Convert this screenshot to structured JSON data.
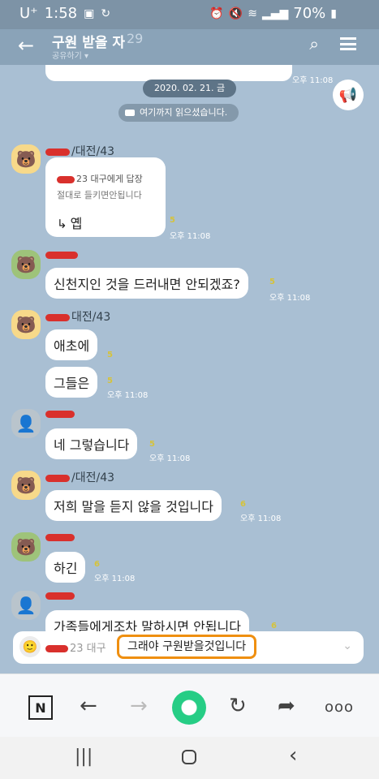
{
  "status_bar": {
    "carrier": "U⁺",
    "time": "1:58",
    "battery": "70%"
  },
  "header": {
    "title": "구원 받을 자",
    "member_count": "29",
    "subtitle": "공유하기 ▾"
  },
  "chat": {
    "partial_time": "오후 11:08",
    "date_divider": "2020. 02. 21. 금",
    "read_marker": "여기까지 읽으셨습니다.",
    "messages": [
      {
        "sender": "/대전/43",
        "reply_head": "23 대구에게 답장",
        "reply_quote": "절대로 들키면안됩니다",
        "text": "옙",
        "count": "5",
        "time": "오후 11:08"
      },
      {
        "text": "신천지인 것을 드러내면 안되겠죠?",
        "count": "5",
        "time": "오후 11:08"
      },
      {
        "sender": "대전/43",
        "text": "애초에",
        "count": "5"
      },
      {
        "text": "그들은",
        "count": "5",
        "time": "오후 11:08"
      },
      {
        "text": "네 그렇습니다",
        "count": "5",
        "time": "오후 11:08"
      },
      {
        "sender": "/대전/43",
        "text": "저희 말을 듣지 않을 것입니다",
        "count": "6",
        "time": "오후 11:08"
      },
      {
        "text": "하긴",
        "count": "6",
        "time": "오후 11:08"
      },
      {
        "text": "가족들에게조차 말하시면 안됩니다",
        "count": "6"
      }
    ]
  },
  "notice": {
    "sender": "23 대구",
    "text": "그래야 구원받을것입니다"
  },
  "browser_toolbar": {
    "n_label": "N",
    "back": "←",
    "forward": "→",
    "refresh": "↻",
    "share": "➦",
    "more": "ooo"
  },
  "system_nav": {
    "recents": "|||",
    "back": "‹"
  }
}
